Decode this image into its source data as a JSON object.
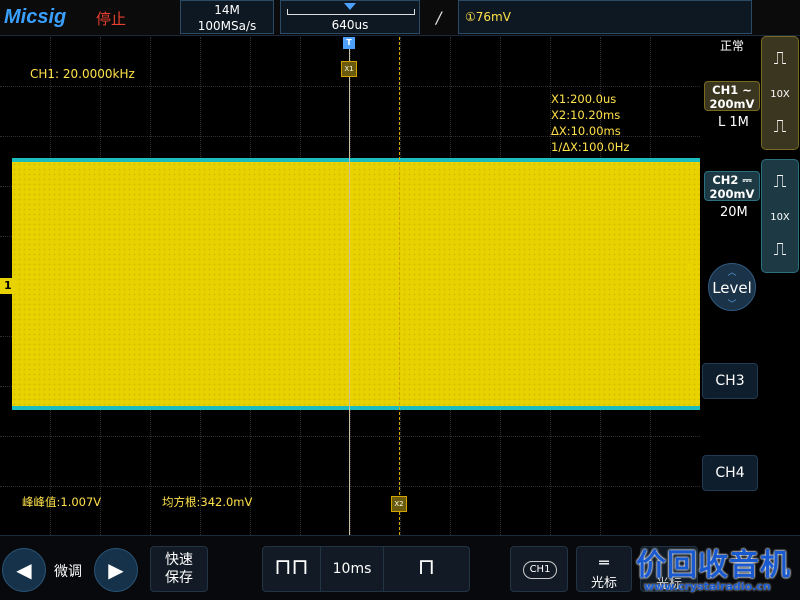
{
  "header": {
    "brand": "Micsig",
    "run_state": "停止",
    "memory_depth": "14M",
    "sample_rate": "100MSa/s",
    "timebase_position": "640us",
    "trigger_edge_icon": "rising-edge-icon",
    "trigger_level": "①76mV"
  },
  "screen": {
    "frequency_readout": "CH1: 20.0000kHz",
    "cursors": {
      "x1": "X1:200.0us",
      "x2": "X2:10.20ms",
      "dx": "ΔX:10.00ms",
      "inv_dx": "1/ΔX:100.0Hz",
      "x1_tag": "X1",
      "x2_tag": "X2",
      "trigger_tag": "T"
    },
    "measurements": {
      "peak_to_peak": "峰峰值:1.007V",
      "rms": "均方根:342.0mV"
    },
    "ch1_marker": "1",
    "colors": {
      "ch1": "#e8d200",
      "ch2": "#1bbcc0",
      "grid": "#2f2f2f",
      "trigger": "#4ea0ff"
    }
  },
  "right_panel": {
    "trigger_mode": "正常",
    "ch1": {
      "label": "CH1",
      "coupling_icon": "ac-coupling-icon",
      "scale": "200mV",
      "impedance": "L 1M",
      "probe": "10X"
    },
    "ch2": {
      "label": "CH2",
      "coupling_icon": "dc-coupling-icon",
      "scale": "200mV",
      "bandwidth": "20M",
      "probe": "10X"
    },
    "level_label": "Level",
    "ch3_label": "CH3",
    "ch4_label": "CH4"
  },
  "bottom_bar": {
    "fine_adjust": "微调",
    "quick_save_line1": "快速",
    "quick_save_line2": "保存",
    "timebase": "10ms",
    "ch1_chip": "CH1",
    "cursor_label": "光标",
    "extra_label": "光标"
  },
  "watermark": {
    "title": "价回收音机",
    "url": "www.crystalradio.cn"
  }
}
